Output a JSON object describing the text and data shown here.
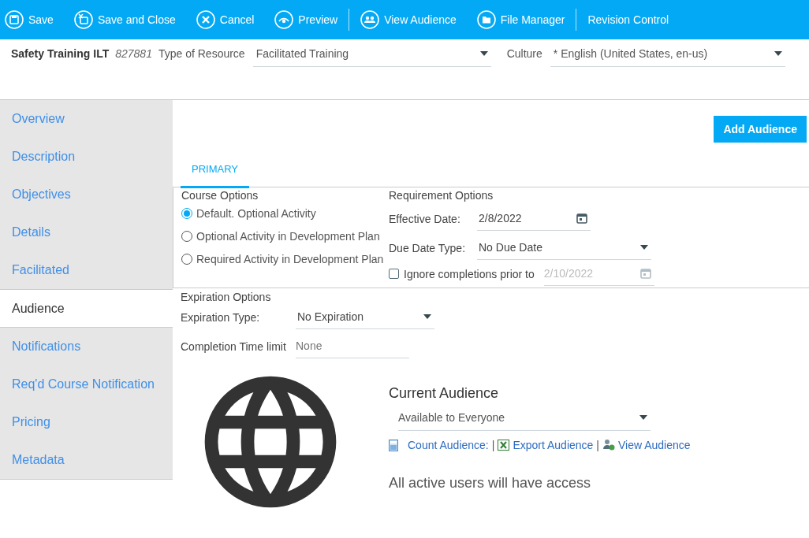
{
  "toolbar": [
    {
      "label": "Save",
      "kind": "save",
      "divider_after": false
    },
    {
      "label": "Save and Close",
      "kind": "save-close",
      "divider_after": false
    },
    {
      "label": "Cancel",
      "kind": "cancel",
      "divider_after": false
    },
    {
      "label": "Preview",
      "kind": "preview",
      "divider_after": true
    },
    {
      "label": "View Audience",
      "kind": "people",
      "divider_after": false
    },
    {
      "label": "File Manager",
      "kind": "folder",
      "divider_after": true
    },
    {
      "label": "Revision Control",
      "kind": "text",
      "divider_after": false
    }
  ],
  "header": {
    "title": "Safety Training ILT",
    "id": "827881",
    "type_label": "Type of Resource",
    "type_value": "Facilitated Training",
    "culture_label": "Culture",
    "culture_value": "* English (United States, en-us)"
  },
  "sidebar": {
    "items": [
      {
        "label": "Overview",
        "selected": false
      },
      {
        "label": "Description",
        "selected": false
      },
      {
        "label": "Objectives",
        "selected": false
      },
      {
        "label": "Details",
        "selected": false
      },
      {
        "label": "Facilitated",
        "selected": false
      },
      {
        "label": "Audience",
        "selected": true
      },
      {
        "label": "Notifications",
        "selected": false
      },
      {
        "label": "Req'd Course Notification",
        "selected": false
      },
      {
        "label": "Pricing",
        "selected": false
      },
      {
        "label": "Metadata",
        "selected": false
      }
    ]
  },
  "add_button": "Add Audience",
  "tabs": [
    {
      "label": "PRIMARY",
      "selected": true
    }
  ],
  "course_options": {
    "title": "Course Options",
    "options": [
      {
        "label": "Default. Optional Activity",
        "selected": true
      },
      {
        "label": "Optional Activity in Development Plan",
        "selected": false
      },
      {
        "label": "Required Activity in Development Plan",
        "selected": false
      }
    ]
  },
  "requirement_options": {
    "title": "Requirement Options",
    "effective_label": "Effective Date:",
    "effective_value": "2/8/2022",
    "due_label": "Due Date Type:",
    "due_value": "No Due Date",
    "ignore_label": "Ignore completions prior to",
    "ignore_checked": false,
    "ignore_value": "2/10/2022"
  },
  "expiration_options": {
    "title": "Expiration Options",
    "type_label": "Expiration Type:",
    "type_value": "No Expiration",
    "limit_label": "Completion Time limit",
    "limit_placeholder": "None"
  },
  "audience": {
    "title": "Current Audience",
    "value": "Available to Everyone",
    "links": [
      {
        "kind": "count",
        "label": "Count Audience:"
      },
      {
        "kind": "separator",
        "label": "|"
      },
      {
        "kind": "export",
        "label": "Export Audience"
      },
      {
        "kind": "separator",
        "label": "|"
      },
      {
        "kind": "view",
        "label": "View Audience"
      }
    ],
    "note": "All active users will have access"
  }
}
